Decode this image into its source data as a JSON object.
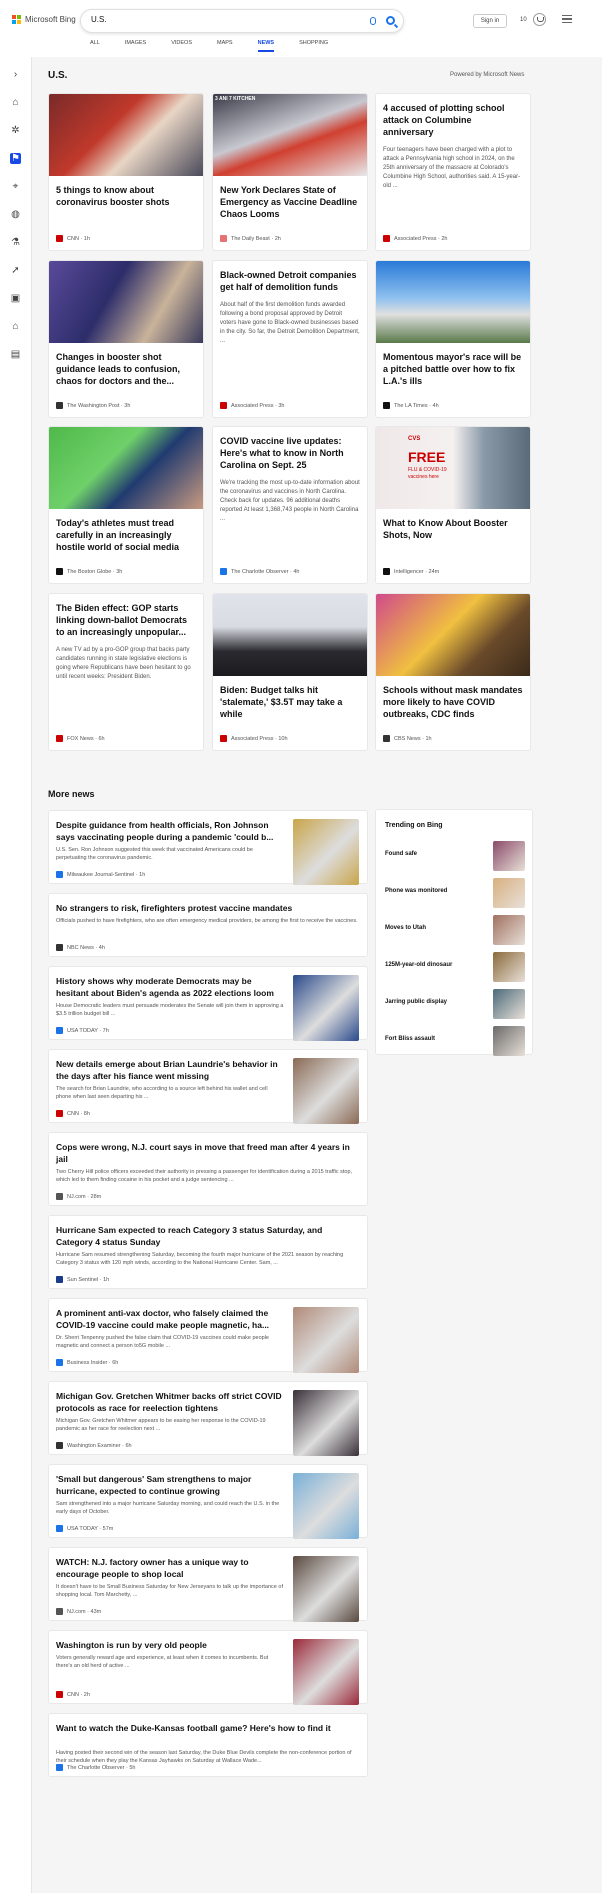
{
  "header": {
    "logo_text": "Microsoft Bing",
    "search_value": "U.S.",
    "signin_label": "Sign in",
    "rewards_count": "10"
  },
  "tabs": [
    {
      "label": "ALL"
    },
    {
      "label": "IMAGES"
    },
    {
      "label": "VIDEOS"
    },
    {
      "label": "MAPS"
    },
    {
      "label": "NEWS",
      "active": true
    },
    {
      "label": "SHOPPING"
    }
  ],
  "section": {
    "title": "U.S.",
    "powered": "Powered by Microsoft News"
  },
  "top_cards": [
    {
      "title": "5 things to know about coronavirus booster shots",
      "summary": "",
      "source": "CNN · 1h",
      "icon_color": "#cc0000",
      "img": "nurse-vaccine"
    },
    {
      "title": "New York Declares State of Emergency as Vaccine Deadline Chaos Looms",
      "summary": "",
      "source": "The Daily Beast · 2h",
      "icon_color": "#e57373",
      "img": "ambulance"
    },
    {
      "title": "4 accused of plotting school attack on Columbine anniversary",
      "summary": "Four teenagers have been charged with a plot to attack a Pennsylvania high school in 2024, on the 25th anniversary of the massacre at Colorado's Columbine High School, authorities said. A 15-year-old ...",
      "source": "Associated Press · 2h",
      "icon_color": "#cc0000",
      "img": ""
    },
    {
      "title": "Changes in booster shot guidance leads to confusion, chaos for doctors and the...",
      "summary": "",
      "source": "The Washington Post · 3h",
      "icon_color": "#333333",
      "img": "clinic"
    },
    {
      "title": "Black-owned Detroit companies get half of demolition funds",
      "summary": "About half of the first demolition funds awarded following a bond proposal approved by Detroit voters have gone to Black-owned businesses based in the city. So far, the Detroit Demolition Department, ...",
      "source": "Associated Press · 3h",
      "icon_color": "#cc0000",
      "img": ""
    },
    {
      "title": "Momentous mayor's race will be a pitched battle over how to fix L.A.'s ills",
      "summary": "",
      "source": "The LA Times · 4h",
      "icon_color": "#111111",
      "img": "city-hall"
    },
    {
      "title": "Today's athletes must tread carefully in an increasingly hostile world of social media",
      "summary": "",
      "source": "The Boston Globe · 3h",
      "icon_color": "#111111",
      "img": "coach"
    },
    {
      "title": "COVID vaccine live updates: Here's what to know in North Carolina on Sept. 25",
      "summary": "We're tracking the most up-to-date information about the coronavirus and vaccines in North Carolina. Check back for updates. 96 additional deaths reported At least 1,368,743 people in North Carolina ...",
      "source": "The Charlotte Observer · 4h",
      "icon_color": "#1a73e8",
      "img": ""
    },
    {
      "title": "What to Know About Booster Shots, Now",
      "summary": "",
      "source": "Intelligencer · 24m",
      "icon_color": "#111111",
      "img": "cvs"
    },
    {
      "title": "The Biden effect: GOP starts linking down-ballot Democrats to an increasingly unpopular...",
      "summary": "A new TV ad by a pro-GOP group that backs party candidates running in state legislative elections is going where Republicans have been hesitant to go until recent weeks: President Biden.",
      "source": "FOX News · 6h",
      "icon_color": "#cc0000",
      "img": ""
    },
    {
      "title": "Biden: Budget talks hit 'stalemate,' $3.5T may take a while",
      "summary": "",
      "source": "Associated Press · 10h",
      "icon_color": "#cc0000",
      "img": "biden"
    },
    {
      "title": "Schools without mask mandates more likely to have COVID outbreaks, CDC finds",
      "summary": "",
      "source": "CBS News · 1h",
      "icon_color": "#333333",
      "img": "classroom"
    }
  ],
  "cvs_img": {
    "brand": "CVS",
    "free": "FREE",
    "sub": "FLU & COVID-19 vaccines here"
  },
  "ambulance_img": {
    "text": "3 ANI 7 KITCHEN"
  },
  "more_news": {
    "title": "More news",
    "items": [
      {
        "title": "Despite guidance from health officials, Ron Johnson says vaccinating people during a pandemic 'could b...",
        "desc": "U.S. Sen. Ron Johnson suggested this week that vaccinated Americans could be perpetuating the coronavirus pandemic.",
        "source": "Milwaukee Journal-Sentinel · 1h",
        "icon_color": "#1a73e8",
        "thumb": "#c9a54a"
      },
      {
        "title": "No strangers to risk, firefighters protest vaccine mandates",
        "desc": "Officials pushed to have firefighters, who are often emergency medical providers, be among the first to receive the vaccines.",
        "source": "NBC News · 4h",
        "icon_color": "#333333",
        "thumb": ""
      },
      {
        "title": "History shows why moderate Democrats may be hesitant about Biden's agenda as 2022 elections loom",
        "desc": "House Democratic leaders must persuade moderates the Senate will join them in approving a $3.5 trillion budget bill ...",
        "source": "USA TODAY · 7h",
        "icon_color": "#1a73e8",
        "thumb": "#2a4a8c"
      },
      {
        "title": "New details emerge about Brian Laundrie's behavior in the days after his fiance went missing",
        "desc": "The search for Brian Laundrie, who according to a source left behind his wallet and cell phone when last seen departing his ...",
        "source": "CNN · 8h",
        "icon_color": "#cc0000",
        "thumb": "#8a6a55"
      },
      {
        "title": "Cops were wrong, N.J. court says in move that freed man after 4 years in jail",
        "desc": "Two Cherry Hill police officers exceeded their authority in pressing a passenger for identification during a 2015 traffic stop, which led to them finding cocaine in his pocket and a judge sentencing ...",
        "source": "NJ.com · 28m",
        "icon_color": "#555555",
        "thumb": ""
      },
      {
        "title": "Hurricane Sam expected to reach Category 3 status Saturday, and Category 4 status Sunday",
        "desc": "Hurricane Sam resumed strengthening Saturday, becoming the fourth major hurricane of the 2021 season by reaching Category 3 status with 120 mph winds, according to the National Hurricane Center. Sam, ...",
        "source": "Sun Sentinel · 1h",
        "icon_color": "#1a3a8c",
        "thumb": ""
      },
      {
        "title": "A prominent anti-vax doctor, who falsely claimed the COVID-19 vaccine could make people magnetic, ha...",
        "desc": "Dr. Sherri Tenpenny pushed the false claim that COVID-19 vaccines could make people magnetic and connect a person to5G mobile ...",
        "source": "Business Insider · 6h",
        "icon_color": "#1a73e8",
        "thumb": "#b08a78"
      },
      {
        "title": "Michigan Gov. Gretchen Whitmer backs off strict COVID protocols as race for reelection tightens",
        "desc": "Michigan Gov. Gretchen Whitmer appears to be easing her response to the COVID-19 pandemic as her race for reelection next ...",
        "source": "Washington Examiner · 6h",
        "icon_color": "#333333",
        "thumb": "#3a3038"
      },
      {
        "title": "'Small but dangerous' Sam strengthens to major hurricane, expected to continue growing",
        "desc": "Sam strengthened into a major hurricane Saturday morning, and could reach the U.S. in the early days of October.",
        "source": "USA TODAY · 57m",
        "icon_color": "#1a73e8",
        "thumb": "#7ab0d8"
      },
      {
        "title": "WATCH: N.J. factory owner has a unique way to encourage people to shop local",
        "desc": "It doesn't have to be Small Business Saturday for New Jerseyans to talk up the importance of shopping local. Tom Marchetty, ...",
        "source": "NJ.com · 43m",
        "icon_color": "#555555",
        "thumb": "#5a4a40"
      },
      {
        "title": "Washington is run by very old people",
        "desc": "Voters generally reward age and experience, at least when it comes to incumbents. But there's an old herd of active ...",
        "source": "CNN · 2h",
        "icon_color": "#cc0000",
        "thumb": "#9a2a3a"
      },
      {
        "title": "Want to watch the Duke-Kansas football game? Here's how to find it",
        "desc": "Having posted their second win of the season last Saturday, the Duke Blue Devils complete the non-conference portion of their schedule when they play the Kansas Jayhawks on Saturday at Wallace Wade...",
        "source": "The Charlotte Observer · 5h",
        "icon_color": "#1a73e8",
        "thumb": ""
      }
    ]
  },
  "trending": {
    "title": "Trending on Bing",
    "items": [
      {
        "label": "Found safe",
        "color": "#8a4a6a"
      },
      {
        "label": "Phone was monitored",
        "color": "#d8b080"
      },
      {
        "label": "Moves to Utah",
        "color": "#a07060"
      },
      {
        "label": "125M-year-old dinosaur",
        "color": "#8a6a3a"
      },
      {
        "label": "Jarring public display",
        "color": "#4a6a7a"
      },
      {
        "label": "Fort Bliss assault",
        "color": "#6a6a6a"
      }
    ]
  },
  "footer": "",
  "colors": {
    "accent": "#174ae4",
    "background": "#f5f5f5"
  }
}
